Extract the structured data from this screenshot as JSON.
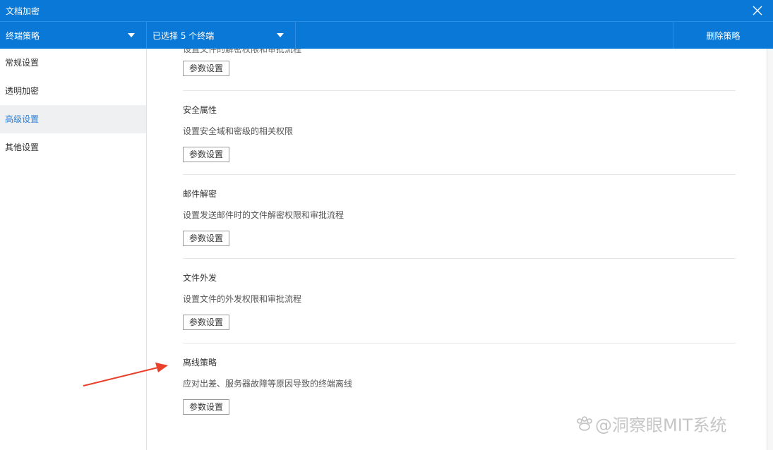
{
  "window": {
    "title": "文档加密",
    "close_icon": "close-icon"
  },
  "toolbar": {
    "policy_label": "终端策略",
    "terminals_label": "已选择 5 个终端",
    "delete_label": "删除策略"
  },
  "sidebar": {
    "items": [
      {
        "label": "常规设置",
        "active": false
      },
      {
        "label": "透明加密",
        "active": false
      },
      {
        "label": "高级设置",
        "active": true
      },
      {
        "label": "其他设置",
        "active": false
      }
    ]
  },
  "sections": {
    "clipped_desc": "设置文件的解密权限和审批流程",
    "button_label": "参数设置",
    "items": [
      {
        "title": "安全属性",
        "desc": "设置安全域和密级的相关权限"
      },
      {
        "title": "邮件解密",
        "desc": "设置发送邮件时的文件解密权限和审批流程"
      },
      {
        "title": "文件外发",
        "desc": "设置文件的外发权限和审批流程"
      },
      {
        "title": "离线策略",
        "desc": "应对出差、服务器故障等原因导致的终端离线"
      }
    ]
  },
  "watermark": "@洞察眼MIT系统",
  "colors": {
    "titlebar": "#0a78d7",
    "active_text": "#2a7fd4",
    "arrow": "#e8412c"
  }
}
